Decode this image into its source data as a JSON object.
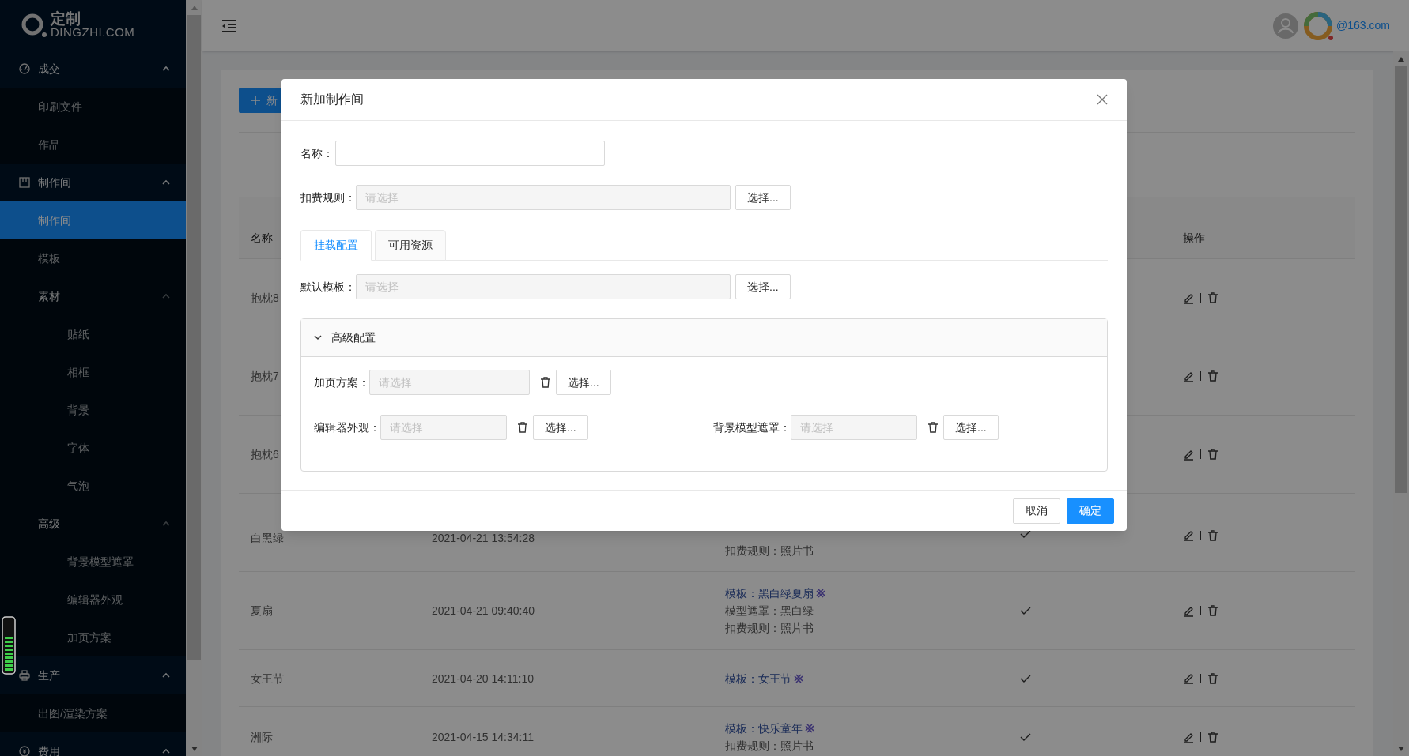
{
  "logo": {
    "name": "定制",
    "domain": "DINGZHI.COM"
  },
  "sidebar": {
    "items": [
      {
        "label": "成交",
        "selected": false,
        "expanded": true,
        "children": [
          {
            "label": "印刷文件",
            "selected": false
          },
          {
            "label": "作品",
            "selected": false
          }
        ]
      },
      {
        "label": "制作间",
        "selected": false,
        "expanded": true,
        "children": [
          {
            "label": "制作间",
            "selected": true
          },
          {
            "label": "模板",
            "selected": false
          },
          {
            "label": "素材",
            "selected": false,
            "expanded": true,
            "children": [
              {
                "label": "贴纸",
                "selected": false
              },
              {
                "label": "相框",
                "selected": false
              },
              {
                "label": "背景",
                "selected": false
              },
              {
                "label": "字体",
                "selected": false
              },
              {
                "label": "气泡",
                "selected": false
              }
            ]
          },
          {
            "label": "高级",
            "selected": false,
            "expanded": true,
            "children": [
              {
                "label": "背景模型遮罩",
                "selected": false
              },
              {
                "label": "编辑器外观",
                "selected": false
              },
              {
                "label": "加页方案",
                "selected": false
              }
            ]
          }
        ]
      },
      {
        "label": "生产",
        "selected": false,
        "expanded": true,
        "children": [
          {
            "label": "出图/渲染方案",
            "selected": false
          }
        ]
      },
      {
        "label": "费用",
        "selected": false,
        "expanded": true
      }
    ]
  },
  "header": {
    "user": "@163.com"
  },
  "table": {
    "new_button": "新",
    "columns": [
      "名称",
      "操作"
    ],
    "rows": [
      {
        "name": "抱枕8"
      },
      {
        "name": "抱枕7"
      },
      {
        "name": "抱枕6"
      },
      {
        "name": "白黑绿",
        "time": "2021-04-21 13:54:28",
        "details": [
          {
            "kind": "text",
            "text": "扣费规则：照片书"
          }
        ],
        "checked": true
      },
      {
        "name": "夏扇",
        "time": "2021-04-21 09:40:40",
        "details": [
          {
            "kind": "template",
            "text": "模板：黑白绿夏扇"
          },
          {
            "kind": "text",
            "text": "模型遮罩：黑白绿"
          },
          {
            "kind": "text",
            "text": "扣费规则：照片书"
          }
        ],
        "checked": true
      },
      {
        "name": "女王节",
        "time": "2021-04-20 14:11:10",
        "details": [
          {
            "kind": "template",
            "text": "模板：女王节"
          }
        ],
        "checked": true
      },
      {
        "name": "洲际",
        "time": "2021-04-15 14:34:11",
        "details": [
          {
            "kind": "template",
            "text": "模板：快乐童年"
          },
          {
            "kind": "text",
            "text": "扣费规则：照片书"
          }
        ],
        "checked": true
      }
    ]
  },
  "dialog": {
    "title": "新加制作间",
    "fields": [
      {
        "kind": "text",
        "label": "名称："
      },
      {
        "kind": "select",
        "label": "扣费规则：",
        "placeholder": "请选择",
        "button": "选择..."
      }
    ],
    "tabs": [
      {
        "label": "挂载配置",
        "selected": true
      },
      {
        "label": "可用资源",
        "selected": false
      }
    ],
    "tab_fields": [
      {
        "kind": "select",
        "label": "默认模板：",
        "placeholder": "请选择",
        "button": "选择..."
      }
    ],
    "advanced": {
      "title": "高级配置",
      "expanded": true,
      "fields": [
        {
          "kind": "select",
          "label": "加页方案：",
          "placeholder": "请选择",
          "button": "选择..."
        },
        {
          "kind": "select",
          "label": "编辑器外观：",
          "placeholder": "请选择",
          "button": "选择..."
        },
        {
          "kind": "select",
          "label": "背景模型遮罩：",
          "placeholder": "请选择",
          "button": "选择..."
        }
      ]
    },
    "buttons": [
      {
        "kind": "default",
        "label": "取消"
      },
      {
        "kind": "primary",
        "label": "确定"
      }
    ]
  }
}
